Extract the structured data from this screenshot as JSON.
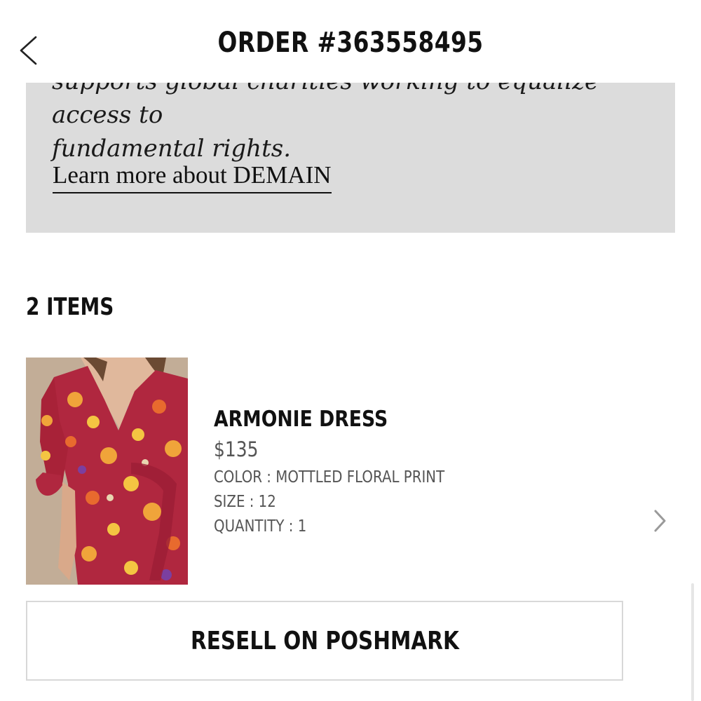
{
  "header": {
    "title": "ORDER #363558495",
    "back_icon": "chevron-left-icon"
  },
  "info_panel": {
    "text_partial": "supports global charities working to equalize access to",
    "text_end": "fundamental rights.",
    "link_label": "Learn more about DEMAIN",
    "background_color": "#dcdcdc"
  },
  "items_section": {
    "heading": "2 ITEMS"
  },
  "product": {
    "name": "ARMONIE DRESS",
    "price": "$135",
    "color": "COLOR : MOTTLED FLORAL PRINT",
    "size": "SIZE : 12",
    "quantity": "QUANTITY : 1",
    "image": "floral-wrap-dress-photo",
    "chevron_icon": "chevron-right-icon"
  },
  "actions": {
    "resell_label": "RESELL ON POSHMARK"
  }
}
